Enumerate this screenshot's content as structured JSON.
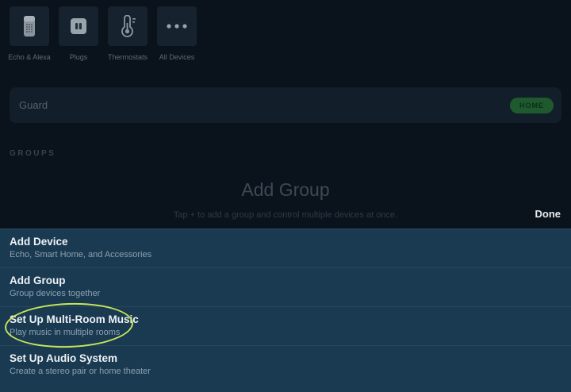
{
  "device_categories": [
    {
      "label": "Echo & Alexa",
      "icon": "echo-speaker-icon"
    },
    {
      "label": "Plugs",
      "icon": "plug-icon"
    },
    {
      "label": "Thermostats",
      "icon": "thermostat-icon"
    },
    {
      "label": "All Devices",
      "icon": "ellipsis-icon"
    }
  ],
  "guard": {
    "label": "Guard",
    "status_label": "HOME"
  },
  "groups": {
    "section_label": "GROUPS",
    "empty_title": "Add Group",
    "empty_subtitle": "Tap + to add a group and control multiple devices at once."
  },
  "sheet": {
    "done_label": "Done",
    "items": [
      {
        "title": "Add Device",
        "subtitle": "Echo, Smart Home, and Accessories",
        "highlighted": false
      },
      {
        "title": "Add Group",
        "subtitle": "Group devices together",
        "highlighted": false
      },
      {
        "title": "Set Up Multi-Room Music",
        "subtitle": "Play music in multiple rooms",
        "highlighted": true
      },
      {
        "title": "Set Up Audio System",
        "subtitle": "Create a stereo pair or home theater",
        "highlighted": false
      }
    ]
  },
  "colors": {
    "page_bg": "#0A121C",
    "tile_bg": "#16222E",
    "card_bg": "#121E2A",
    "sheet_bg": "#1A3A52",
    "divider": "#27475F",
    "guard_home_green": "#1F5A2E",
    "annotation_green": "#C5E65A",
    "title_text": "#EDF2F4",
    "subtitle_text": "#8CA0B0"
  }
}
